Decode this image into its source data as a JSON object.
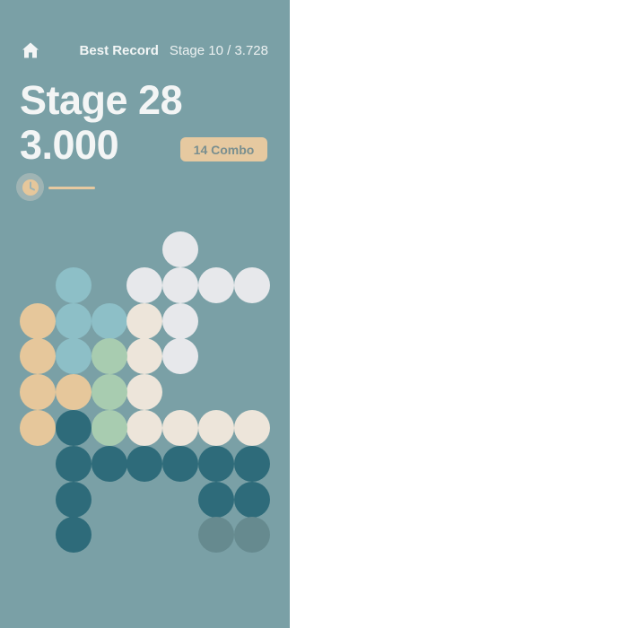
{
  "header": {
    "home_icon": "home-icon",
    "best_record_label": "Best Record",
    "best_record_value": "Stage 10 / 3.728"
  },
  "game": {
    "stage_title": "Stage 28",
    "score": "3.000",
    "combo": "14 Combo",
    "timer_icon": "clock-icon",
    "timer_progress": 1.0
  },
  "colors": {
    "background": "#7aa0a6",
    "white": "#e7e8eb",
    "cream": "#ede5da",
    "tan": "#e6c79b",
    "light_blue": "#8dbfc7",
    "sage": "#a8ccb0",
    "teal": "#2e6b7a",
    "ghost": "#668a8f"
  },
  "board": {
    "cell_colors": [
      "white",
      "cream",
      "tan",
      "light_blue",
      "sage",
      "teal",
      "ghost"
    ],
    "pieces": [
      {
        "color": "white",
        "cells": [
          [
            0,
            4
          ],
          [
            1,
            3
          ],
          [
            1,
            4
          ],
          [
            1,
            5
          ],
          [
            1,
            6
          ],
          [
            2,
            4
          ],
          [
            3,
            4
          ]
        ]
      },
      {
        "color": "light_blue",
        "cells": [
          [
            1,
            1
          ],
          [
            2,
            1
          ],
          [
            2,
            2
          ],
          [
            3,
            1
          ]
        ]
      },
      {
        "color": "tan",
        "cells": [
          [
            2,
            0
          ],
          [
            3,
            0
          ],
          [
            4,
            0
          ],
          [
            4,
            1
          ],
          [
            5,
            0
          ]
        ]
      },
      {
        "color": "cream",
        "cells": [
          [
            2,
            3
          ],
          [
            3,
            3
          ],
          [
            4,
            3
          ],
          [
            5,
            3
          ],
          [
            5,
            4
          ],
          [
            5,
            5
          ],
          [
            5,
            6
          ]
        ]
      },
      {
        "color": "sage",
        "cells": [
          [
            3,
            2
          ],
          [
            4,
            2
          ],
          [
            5,
            2
          ]
        ]
      },
      {
        "color": "teal",
        "cells": [
          [
            5,
            1
          ],
          [
            6,
            1
          ],
          [
            6,
            2
          ],
          [
            6,
            3
          ],
          [
            6,
            4
          ],
          [
            6,
            5
          ],
          [
            6,
            6
          ],
          [
            7,
            1
          ],
          [
            7,
            5
          ],
          [
            7,
            6
          ],
          [
            8,
            1
          ]
        ]
      },
      {
        "color": "ghost",
        "cells": [
          [
            8,
            5
          ],
          [
            8,
            6
          ]
        ]
      }
    ]
  }
}
